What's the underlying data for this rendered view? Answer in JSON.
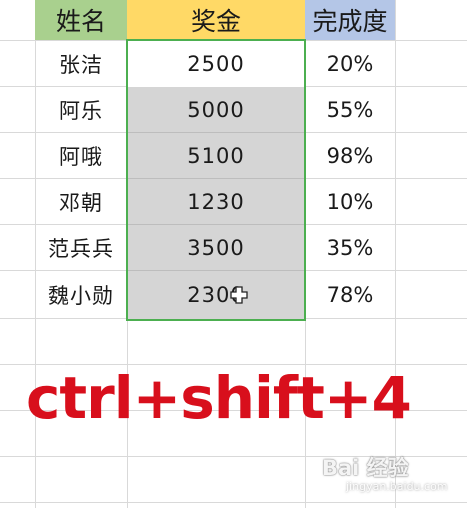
{
  "table": {
    "headers": {
      "name": "姓名",
      "bonus": "奖金",
      "rate": "完成度"
    },
    "rows": [
      {
        "name": "张洁",
        "bonus": "2500",
        "rate": "20%"
      },
      {
        "name": "阿乐",
        "bonus": "5000",
        "rate": "55%"
      },
      {
        "name": "阿哦",
        "bonus": "5100",
        "rate": "98%"
      },
      {
        "name": "邓朝",
        "bonus": "1230",
        "rate": "10%"
      },
      {
        "name": "范兵兵",
        "bonus": "3500",
        "rate": "35%"
      },
      {
        "name": "魏小勋",
        "bonus": "2300",
        "rate": "78%"
      }
    ]
  },
  "overlay": {
    "shortcut_text": "ctrl+shift+4"
  },
  "watermark": {
    "main": "Bai 经验",
    "sub": "jingyan.baidu.com"
  },
  "colors": {
    "header_name": "#a9d08e",
    "header_bonus": "#ffd966",
    "header_rate": "#b4c6e7",
    "selection_border": "#4caf50",
    "shortcut": "#d80f1c"
  },
  "icons": {
    "cursor": "plus-cross-cursor-icon"
  }
}
